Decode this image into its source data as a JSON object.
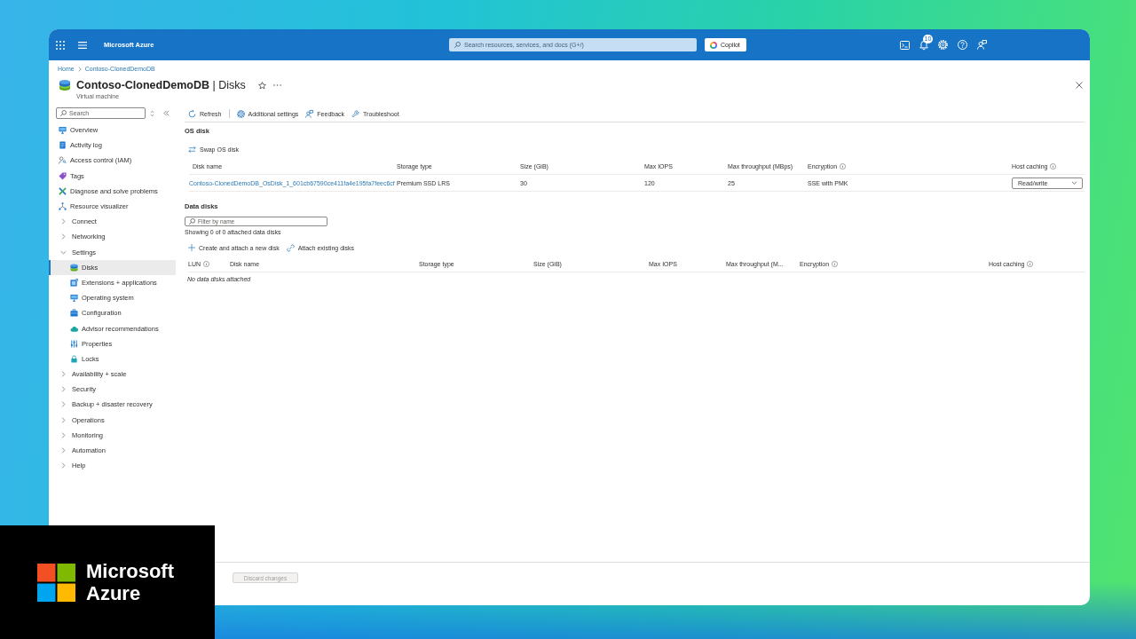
{
  "topbar": {
    "brand": "Microsoft Azure",
    "search": {
      "placeholder": "Search resources, services, and docs (G+/)"
    },
    "copilot": "Copilot",
    "notifications_badge": "10"
  },
  "breadcrumb": [
    "Home",
    "Contoso-ClonedDemoDB"
  ],
  "page": {
    "title": "**Contoso-ClonedDemoDB** | Disks",
    "subtitle": "Virtual machine"
  },
  "sidebar": {
    "search": {
      "placeholder": "Search"
    },
    "items": [
      {
        "label": "Overview",
        "kind": "page",
        "selected": false
      },
      {
        "label": "Activity log",
        "kind": "page",
        "selected": false
      },
      {
        "label": "Access control (IAM)",
        "kind": "page",
        "selected": false
      },
      {
        "label": "Tags",
        "kind": "page",
        "selected": false
      },
      {
        "label": "Diagnose and solve problems",
        "kind": "page",
        "selected": false
      },
      {
        "label": "Resource visualizer",
        "kind": "page",
        "selected": false
      },
      {
        "label": "Connect",
        "kind": "group",
        "selected": false,
        "expanded": false
      },
      {
        "label": "Networking",
        "kind": "group",
        "selected": false,
        "expanded": false
      },
      {
        "label": "Settings",
        "kind": "group",
        "selected": false,
        "expanded": true,
        "children": [
          {
            "label": "Disks",
            "kind": "page",
            "selected": true
          },
          {
            "label": "Extensions + applications",
            "kind": "page",
            "selected": false
          },
          {
            "label": "Operating system",
            "kind": "page",
            "selected": false
          },
          {
            "label": "Configuration",
            "kind": "page",
            "selected": false
          },
          {
            "label": "Advisor recommendations",
            "kind": "page",
            "selected": false
          },
          {
            "label": "Properties",
            "kind": "page",
            "selected": false
          },
          {
            "label": "Locks",
            "kind": "page",
            "selected": false
          }
        ]
      },
      {
        "label": "Availability + scale",
        "kind": "group",
        "selected": false,
        "expanded": false
      },
      {
        "label": "Security",
        "kind": "group",
        "selected": false,
        "expanded": false
      },
      {
        "label": "Backup + disaster recovery",
        "kind": "group",
        "selected": false,
        "expanded": false
      },
      {
        "label": "Operations",
        "kind": "group",
        "selected": false,
        "expanded": false
      },
      {
        "label": "Monitoring",
        "kind": "group",
        "selected": false,
        "expanded": false
      },
      {
        "label": "Automation",
        "kind": "group",
        "selected": false,
        "expanded": false
      },
      {
        "label": "Help",
        "kind": "group",
        "selected": false,
        "expanded": false
      }
    ]
  },
  "toolbar": [
    {
      "label": "Refresh"
    },
    {
      "label": "Additional settings"
    },
    {
      "label": "Feedback"
    },
    {
      "label": "Troubleshoot"
    }
  ],
  "os_disk": {
    "heading": "OS disk",
    "action": "Swap OS disk",
    "columns": [
      {
        "label": "Disk name",
        "info": false
      },
      {
        "label": "Storage type",
        "info": false
      },
      {
        "label": "Size (GiB)",
        "info": false
      },
      {
        "label": "Max IOPS",
        "info": false
      },
      {
        "label": "Max throughput (MBps)",
        "info": false
      },
      {
        "label": "Encryption",
        "info": true
      },
      {
        "label": "Host caching",
        "info": true
      }
    ],
    "rows": [
      {
        "disk_name": "Contoso-ClonedDemoDB_OsDisk_1_601cb67590ce411fa4e195fa7feec6cf",
        "storage_type": "Premium SSD LRS",
        "size": "30",
        "max_iops": "120",
        "max_throughput": "25",
        "encryption": "SSE with PMK",
        "host_caching": "Read/write"
      }
    ]
  },
  "data_disks": {
    "heading": "Data disks",
    "filter": {
      "placeholder": "Filter by name"
    },
    "summary": "Showing 0 of 0 attached data disks",
    "actions": [
      {
        "label": "Create and attach a new disk"
      },
      {
        "label": "Attach existing disks"
      }
    ],
    "columns": [
      {
        "label": "LUN",
        "info": true
      },
      {
        "label": "Disk name",
        "info": false
      },
      {
        "label": "Storage type",
        "info": false
      },
      {
        "label": "Size (GiB)",
        "info": false
      },
      {
        "label": "Max IOPS",
        "info": false
      },
      {
        "label": "Max throughput (M...",
        "info": false
      },
      {
        "label": "Encryption",
        "info": true
      },
      {
        "label": "Host caching",
        "info": true
      }
    ],
    "empty_message": "No data disks attached"
  },
  "footer": {
    "buttons": [
      {
        "label": "Discard changes",
        "disabled": true
      }
    ]
  },
  "logo_overlay": {
    "lines": [
      "Microsoft",
      "Azure"
    ]
  }
}
